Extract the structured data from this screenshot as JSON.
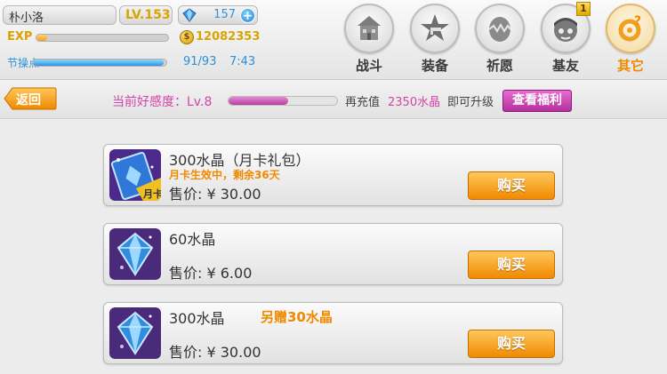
{
  "player": {
    "name": "朴小洛",
    "level": "LV.153",
    "gems": "157",
    "exp_label": "EXP",
    "exp_progress": 0.08,
    "gold": "12082353",
    "stamina_label": "节操点",
    "stamina_progress": 0.98,
    "stamina_value": "91/93",
    "stamina_timer": "7:43"
  },
  "nav": [
    {
      "label": "战斗",
      "icon": "house-icon",
      "active": false
    },
    {
      "label": "装备",
      "icon": "star-gun-icon",
      "active": false
    },
    {
      "label": "祈愿",
      "icon": "wish-egg-icon",
      "active": false
    },
    {
      "label": "基友",
      "icon": "friend-face-icon",
      "active": false,
      "badge": "1"
    },
    {
      "label": "其它",
      "icon": "more-gear-icon",
      "active": true
    }
  ],
  "subbar": {
    "back_label": "返回",
    "favor_label": "当前好感度：Lv.8",
    "favor_progress": 0.55,
    "recharge_label": "再充值",
    "recharge_amount": "2350水晶",
    "upgrade_label": "即可升级",
    "welfare_button": "查看福利"
  },
  "products": [
    {
      "title": "300水晶（月卡礼包）",
      "subtitle": "月卡生效中，剩余36天",
      "bonus": "",
      "price": "售价: ¥ 30.00",
      "buy_label": "购买",
      "icon": "monthly-card-icon",
      "icon_badge": "月卡"
    },
    {
      "title": "60水晶",
      "subtitle": "",
      "bonus": "",
      "price": "售价: ¥ 6.00",
      "buy_label": "购买",
      "icon": "crystal-icon"
    },
    {
      "title": "300水晶",
      "subtitle": "",
      "bonus": "另赠30水晶",
      "price": "售价: ¥ 30.00",
      "buy_label": "购买",
      "icon": "crystal-icon"
    }
  ],
  "colors": {
    "accent_orange": "#f08a00",
    "accent_pink": "#d544a8",
    "accent_blue": "#2c8fd8",
    "gold": "#d9a300"
  }
}
